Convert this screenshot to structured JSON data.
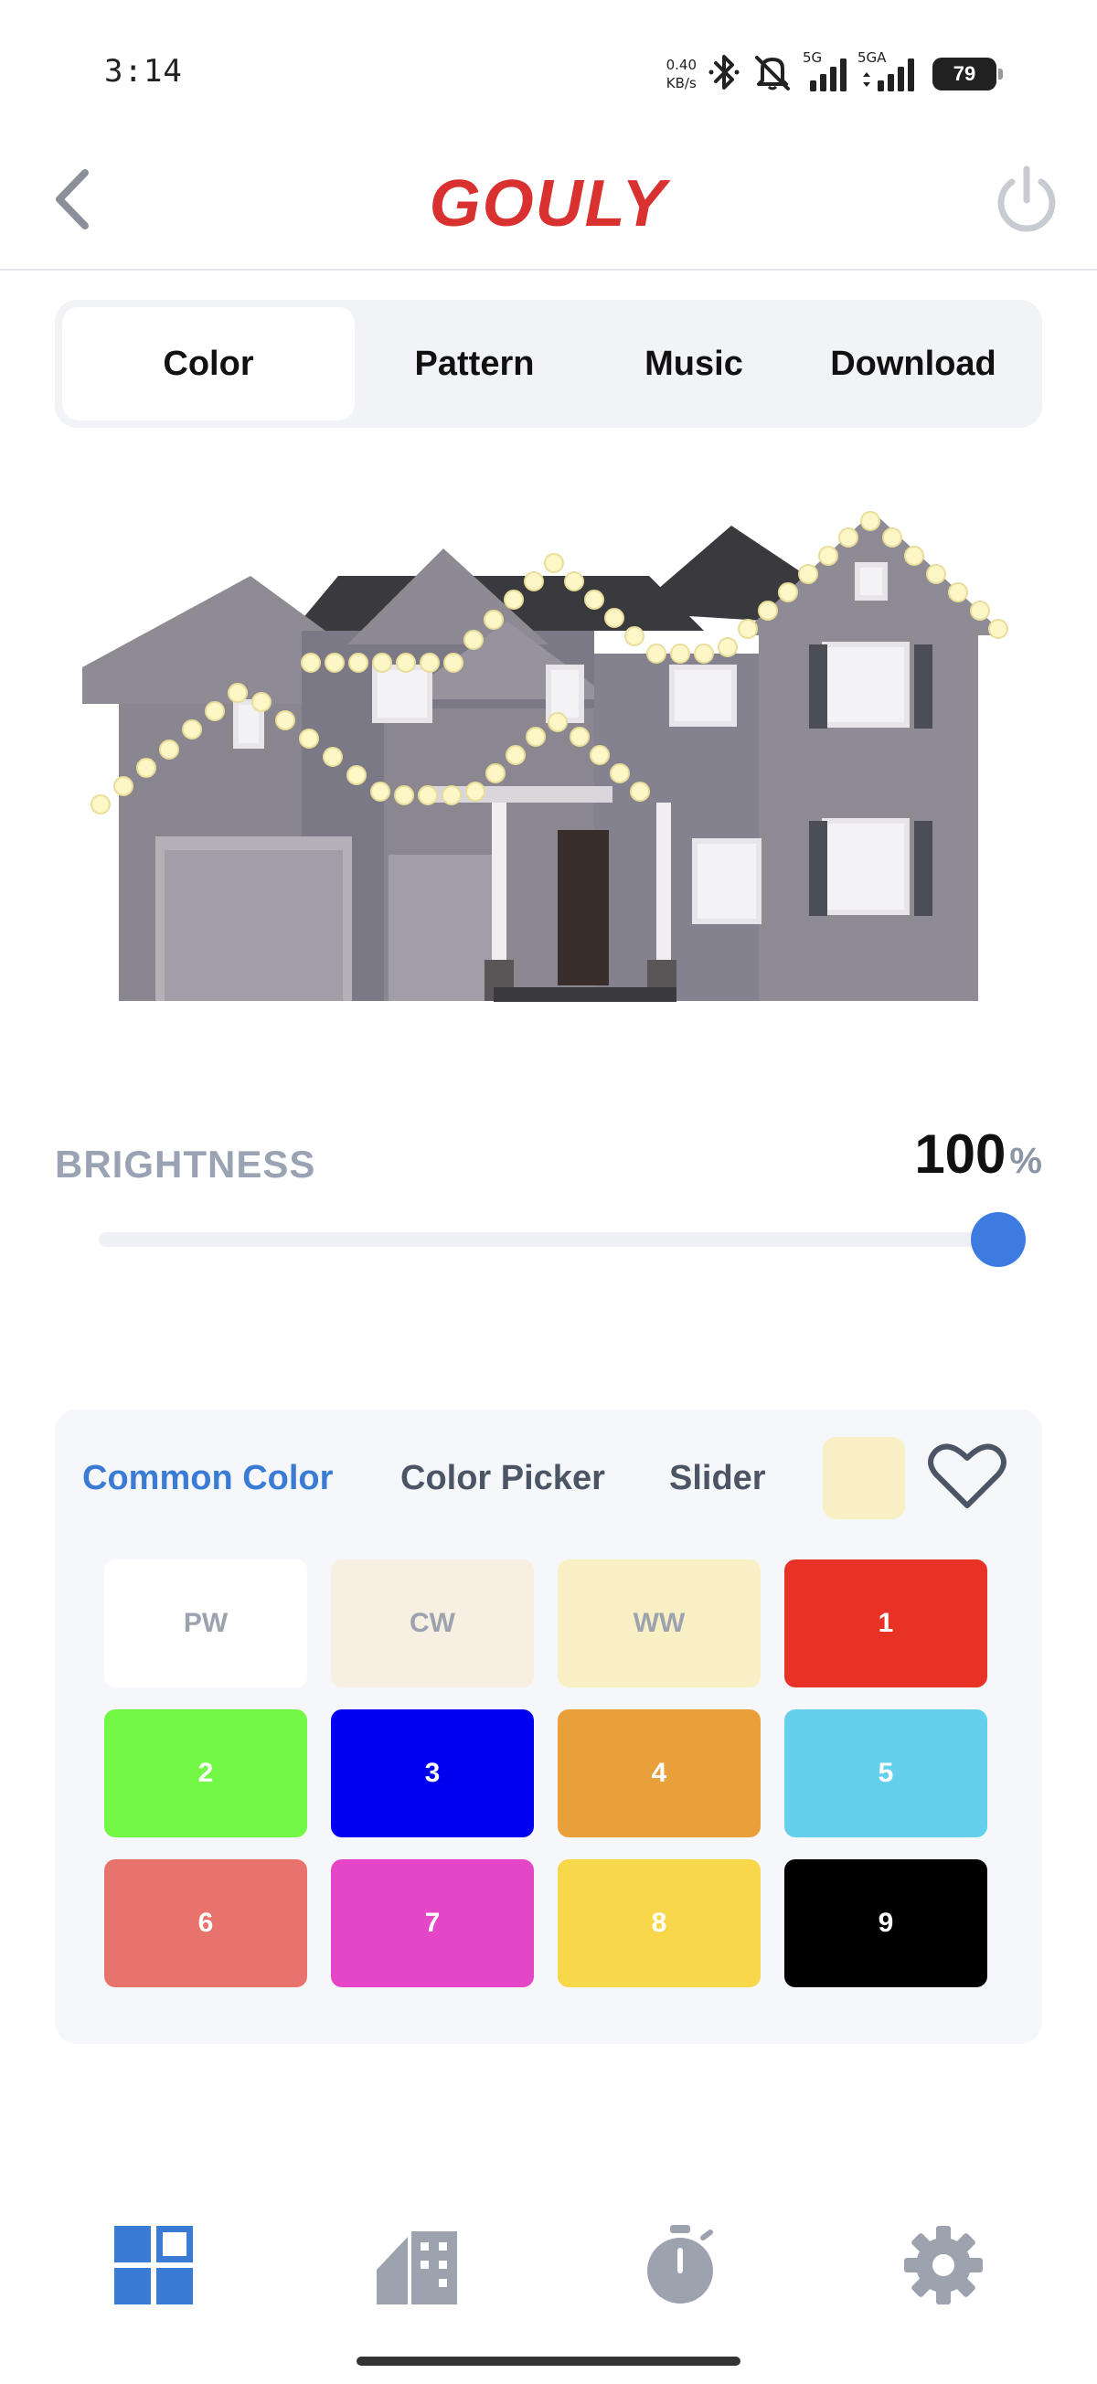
{
  "status_bar": {
    "time": "3:14",
    "net_speed_value": "0.40",
    "net_speed_unit": "KB/s",
    "signal_1_label": "5G",
    "signal_2_label": "5GA",
    "battery": "79",
    "icons": [
      "bluetooth-icon",
      "mute-icon",
      "signal-icon",
      "battery-icon"
    ]
  },
  "header": {
    "brand": "GOULY",
    "icons": [
      "back-arrow-icon",
      "power-icon"
    ],
    "colors": {
      "brand": "#d93030",
      "icons": "#9ca3af"
    }
  },
  "tabs": [
    {
      "label": "Color",
      "active": true
    },
    {
      "label": "Pattern",
      "active": false
    },
    {
      "label": "Music",
      "active": false
    },
    {
      "label": "Download",
      "active": false
    }
  ],
  "brightness": {
    "label": "BRIGHTNESS",
    "value": "100",
    "unit": "%",
    "percent": 100
  },
  "color_panel": {
    "subtabs": [
      {
        "label": "Common Color",
        "active": true
      },
      {
        "label": "Color Picker",
        "active": false
      },
      {
        "label": "Slider",
        "active": false
      }
    ],
    "current_color": "#f8f0c4",
    "favorite_icon": "heart-outline-icon",
    "swatches": [
      {
        "label": "PW",
        "color": "#ffffff",
        "light": true
      },
      {
        "label": "CW",
        "color": "#f6efe2",
        "light": true
      },
      {
        "label": "WW",
        "color": "#f8f0c4",
        "light": true
      },
      {
        "label": "1",
        "color": "#e83226",
        "light": false
      },
      {
        "label": "2",
        "color": "#74f846",
        "light": false
      },
      {
        "label": "3",
        "color": "#0000f0",
        "light": false
      },
      {
        "label": "4",
        "color": "#e9a03a",
        "light": false
      },
      {
        "label": "5",
        "color": "#64d0ec",
        "light": false
      },
      {
        "label": "6",
        "color": "#e8726c",
        "light": false
      },
      {
        "label": "7",
        "color": "#e546c8",
        "light": false
      },
      {
        "label": "8",
        "color": "#f8d84a",
        "light": false
      },
      {
        "label": "9",
        "color": "#000000",
        "light": false
      }
    ]
  },
  "bottom_nav": {
    "items": [
      {
        "icon": "dashboard-grid-icon",
        "active": true
      },
      {
        "icon": "scene-house-icon",
        "active": false
      },
      {
        "icon": "timer-stopwatch-icon",
        "active": false
      },
      {
        "icon": "settings-gear-icon",
        "active": false
      }
    ],
    "colors": {
      "active": "#3a7bd5",
      "inactive": "#9ca3af"
    }
  },
  "colors": {
    "accent": "#3a7bd5",
    "label_gray": "#9aa3b4",
    "panel_bg": "#f6f7fa",
    "tab_bg": "#f2f3f6"
  }
}
